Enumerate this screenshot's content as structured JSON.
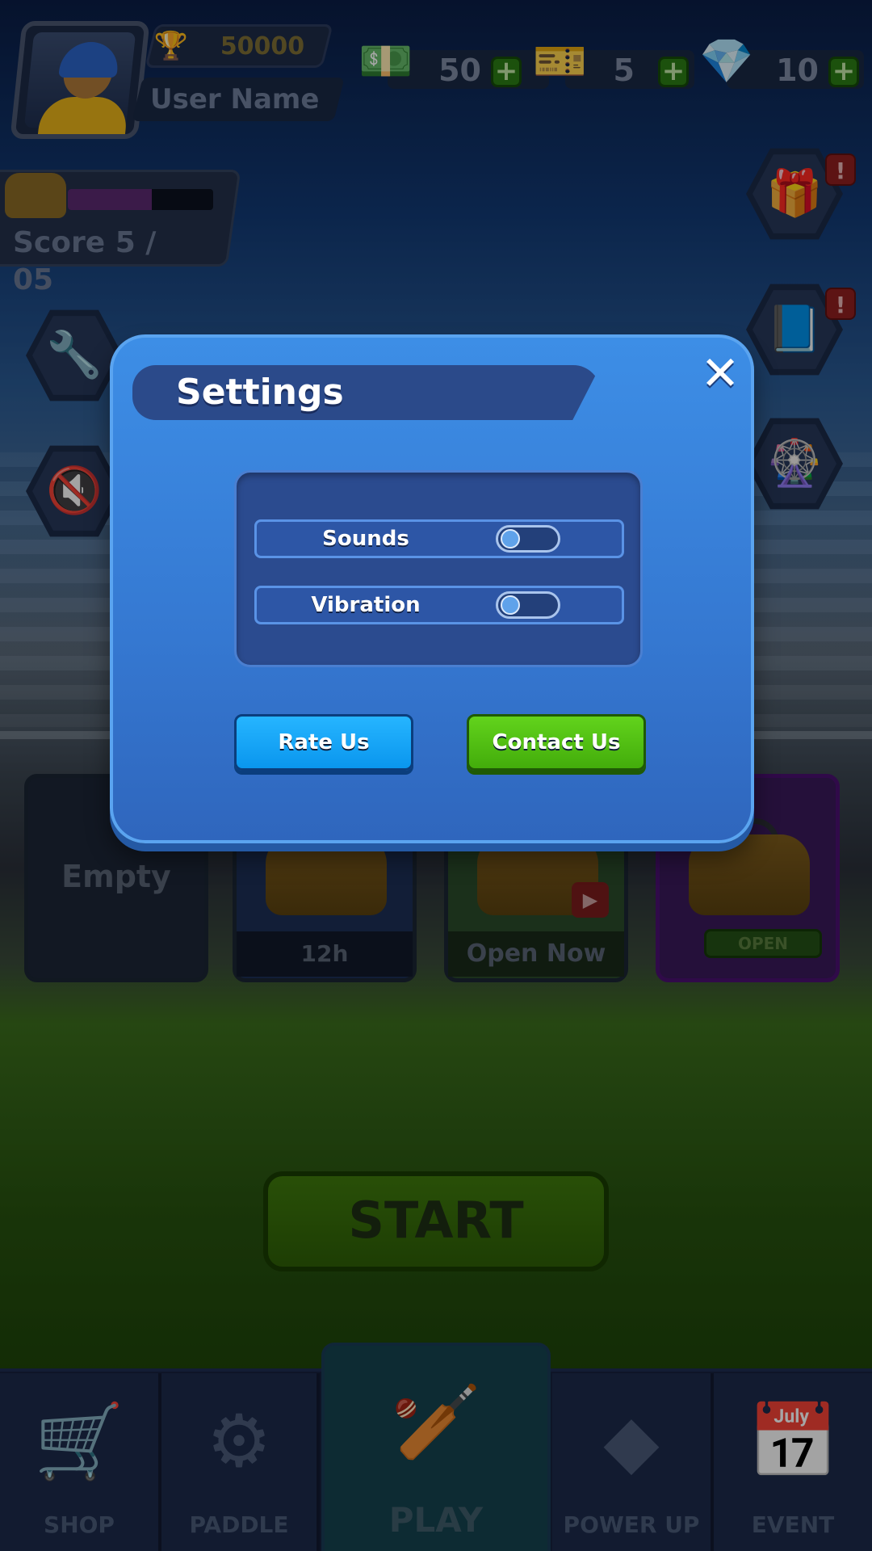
{
  "top_bar": {
    "trophies": "50000",
    "username": "User Name",
    "currencies": [
      {
        "icon": "cash-icon",
        "value": "50"
      },
      {
        "icon": "ticket-icon",
        "value": "5"
      },
      {
        "icon": "gem-icon",
        "value": "10"
      }
    ],
    "plus_label": "+"
  },
  "score": {
    "label": "Score   5 / 05",
    "progress": 0.58
  },
  "side_buttons": {
    "alert": "!"
  },
  "bag_slots": [
    {
      "label": "Empty"
    },
    {
      "label": "12h"
    },
    {
      "label": "Open Now"
    },
    {
      "label": "OPEN"
    }
  ],
  "start_button": "START",
  "bottom_nav": [
    {
      "label": "SHOP",
      "icon": "basket-icon"
    },
    {
      "label": "PADDLE",
      "icon": "paddle-icon"
    },
    {
      "label": "PLAY",
      "icon": "crossed-bats-icon"
    },
    {
      "label": "POWER UP",
      "icon": "powerup-icon"
    },
    {
      "label": "EVENT",
      "icon": "calendar-icon"
    }
  ],
  "settings_dialog": {
    "title": "Settings",
    "close_glyph": "✕",
    "options": [
      {
        "label": "Sounds",
        "enabled": false
      },
      {
        "label": "Vibration",
        "enabled": false
      }
    ],
    "rate_us": "Rate Us",
    "contact_us": "Contact Us"
  },
  "colors": {
    "dialog_blue": "#3578d1",
    "rate_button": "#1aa6f7",
    "contact_button": "#52c214",
    "start_button": "#3f7a0c"
  }
}
